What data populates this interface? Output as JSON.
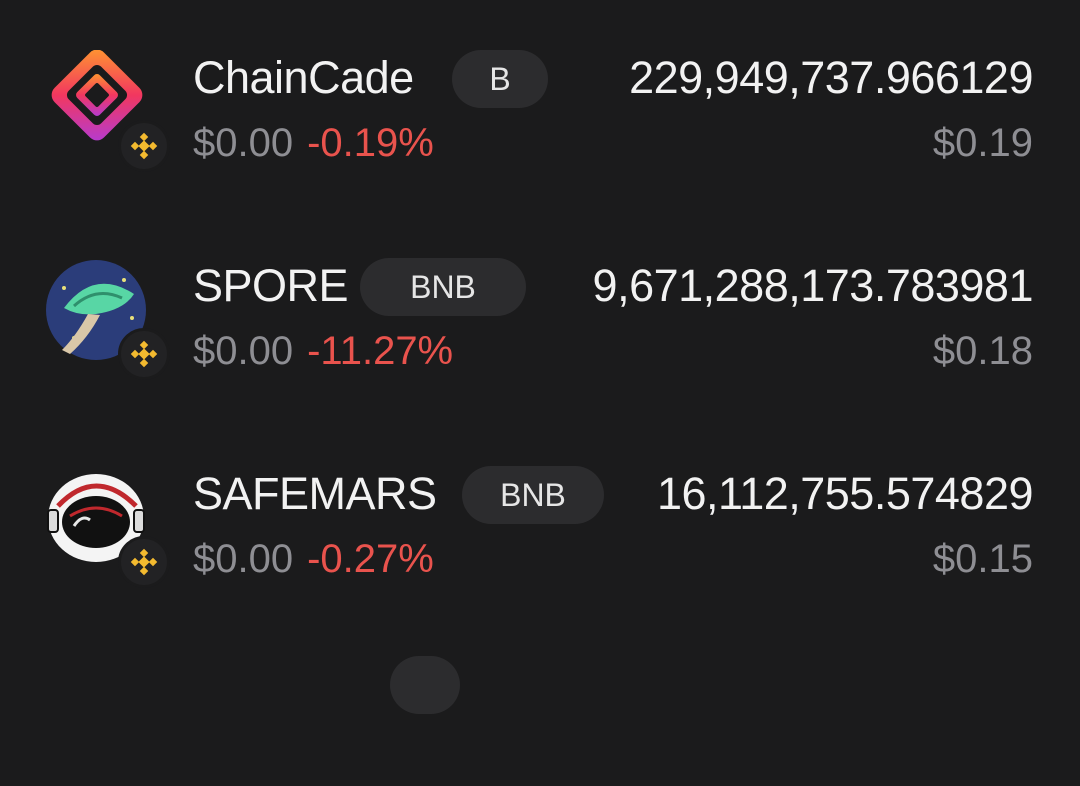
{
  "tokens": [
    {
      "name": "ChainCade",
      "chain": "B",
      "amount": "229,949,737.966129",
      "price": "$0.00",
      "change": "-0.19%",
      "value": "$0.19",
      "icon": "chaincade-logo-icon"
    },
    {
      "name": "SPORE",
      "chain": "BNB",
      "amount": "9,671,288,173.783981",
      "price": "$0.00",
      "change": "-11.27%",
      "value": "$0.18",
      "icon": "spore-mushroom-logo-icon"
    },
    {
      "name": "SAFEMARS",
      "chain": "BNB",
      "amount": "16,112,755.574829",
      "price": "$0.00",
      "change": "-0.27%",
      "value": "$0.15",
      "icon": "safemars-astronaut-logo-icon"
    }
  ],
  "colors": {
    "background": "#1b1b1c",
    "negative": "#e9534d",
    "muted": "#8e8e93",
    "bnb": "#f3ba2f"
  }
}
